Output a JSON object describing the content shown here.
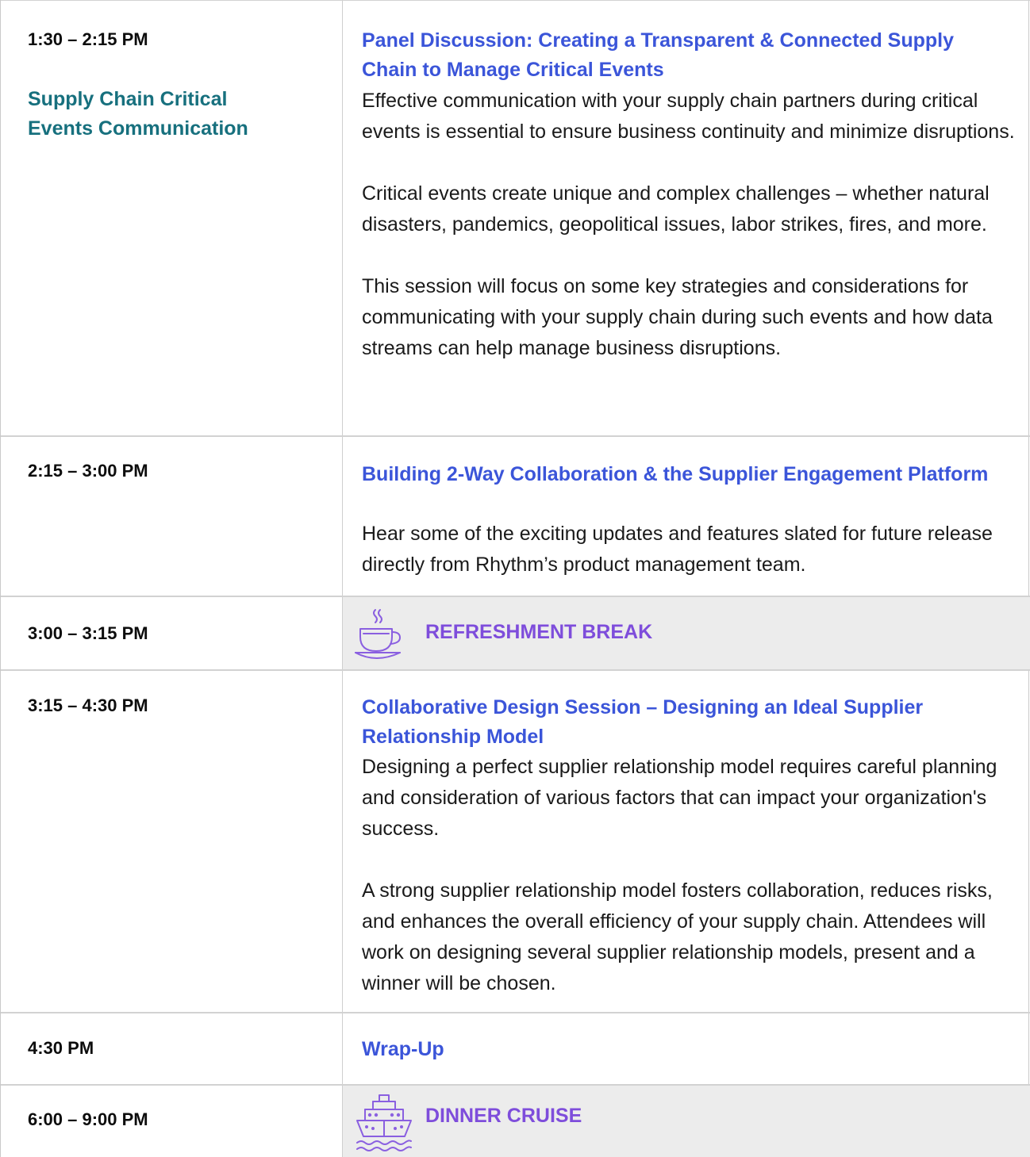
{
  "schedule": [
    {
      "time": "1:30 – 2:15 PM",
      "track": "Supply Chain Critical Events Communication",
      "title": "Panel Discussion: Creating a Transparent & Connected Supply Chain to Manage Critical Events",
      "paragraphs": [
        "Effective communication with your supply chain partners during critical events is essential to ensure business continuity and minimize disruptions.",
        "Critical events create unique and complex challenges – whether natural disasters, pandemics, geopolitical issues, labor strikes, fires, and more.",
        "This session will focus on some key strategies and considerations for communicating with your supply chain during such events and how data streams can help manage business disruptions."
      ]
    },
    {
      "time": "2:15 – 3:00 PM",
      "title": "Building 2-Way Collaboration & the Supplier Engagement Platform",
      "paragraphs": [
        "Hear some of the exciting updates and features slated for future release directly from Rhythm’s product management team."
      ]
    },
    {
      "time": "3:00 – 3:15 PM",
      "label": "REFRESHMENT BREAK",
      "icon": "coffee-cup-icon"
    },
    {
      "time": "3:15 – 4:30 PM",
      "title": "Collaborative Design Session – Designing an Ideal Supplier Relationship Model",
      "paragraphs": [
        "Designing a perfect supplier relationship model requires careful planning and consideration of various factors that can impact your organization's success.",
        "A strong supplier relationship model fosters collaboration, reduces risks, and enhances the overall efficiency of your supply chain. Attendees will work on designing several supplier relationship models, present and a winner will be chosen."
      ]
    },
    {
      "time": "4:30 PM",
      "title": "Wrap-Up"
    },
    {
      "time": "6:00 – 9:00 PM",
      "label": "DINNER CRUISE",
      "icon": "cruise-ship-icon"
    }
  ],
  "colors": {
    "track": "#17707e",
    "title": "#3b55d9",
    "break_label": "#7e4ddb",
    "break_bg": "#ececec"
  }
}
